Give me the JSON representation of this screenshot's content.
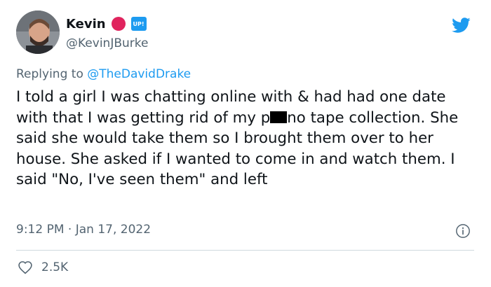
{
  "author": {
    "display_name": "Kevin",
    "handle": "@KevinJBurke",
    "badge_text": "UP!",
    "badge_color": "#1d9bf0",
    "dot_color": "#e0245e"
  },
  "reply": {
    "prefix": "Replying to ",
    "mention": "@TheDavidDrake"
  },
  "text": {
    "part1": "I told a girl I was chatting online with & had had one date with that I was getting rid of my p",
    "part2": "no tape collection. She said she would take them so I brought them over to her house. She asked if I wanted to come in and watch them. I said \"No, I've seen them\" and left"
  },
  "meta": {
    "timestamp": "9:12 PM · Jan 17, 2022"
  },
  "engagement": {
    "likes": "2.5K"
  },
  "colors": {
    "twitter_blue": "#1d9bf0",
    "muted_text": "#536471",
    "divider": "#cfd9de"
  },
  "icons": {
    "brand": "twitter-bird-icon",
    "info": "info-icon",
    "like": "heart-icon"
  }
}
